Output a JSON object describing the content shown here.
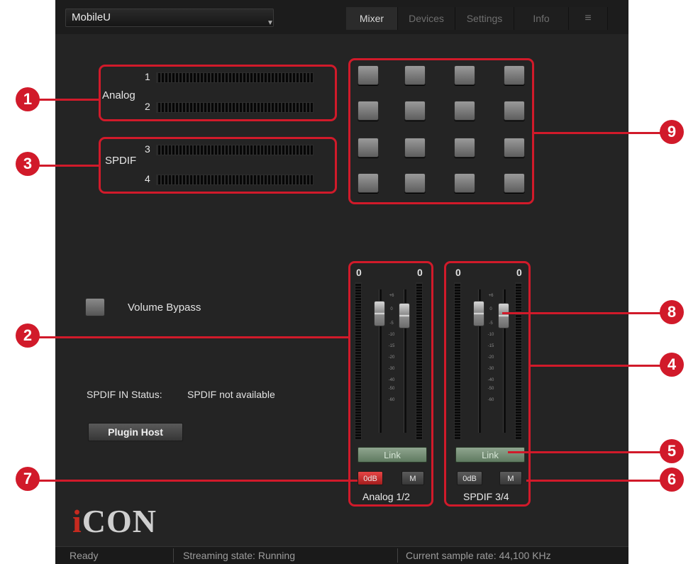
{
  "window": {
    "device_name": "MobileU",
    "tabs": [
      "Mixer",
      "Devices",
      "Settings",
      "Info"
    ],
    "menu_icon": "hamburger-icon"
  },
  "meters": {
    "analog_label": "Analog",
    "spdif_label": "SPDIF",
    "channels": [
      "1",
      "2",
      "3",
      "4"
    ]
  },
  "controls": {
    "volume_bypass_label": "Volume Bypass",
    "spdif_status_label": "SPDIF IN Status:",
    "spdif_status_value": "SPDIF not available",
    "plugin_host_label": "Plugin Host"
  },
  "strips": [
    {
      "left_level": "0",
      "right_level": "0",
      "link_label": "Link",
      "odb_label": "0dB",
      "mute_label": "M",
      "name": "Analog 1/2"
    },
    {
      "left_level": "0",
      "right_level": "0",
      "link_label": "Link",
      "odb_label": "0dB",
      "mute_label": "M",
      "name": "SPDIF 3/4"
    }
  ],
  "scale_marks": [
    "+6",
    "0",
    "-5",
    "-10",
    "-15",
    "-20",
    "-30",
    "-40",
    "-50",
    "-60"
  ],
  "branding": {
    "logo_i": "i",
    "logo_rest": "CON"
  },
  "status": {
    "state": "Ready",
    "streaming": "Streaming state: Running",
    "sample_rate": "Current sample rate: 44,100 KHz"
  },
  "annotations": [
    "1",
    "2",
    "3",
    "4",
    "5",
    "6",
    "7",
    "8",
    "9"
  ],
  "colors": {
    "annotation": "#d11a2a",
    "logo_accent": "#c62a1f",
    "link_button": "#7a947b"
  }
}
